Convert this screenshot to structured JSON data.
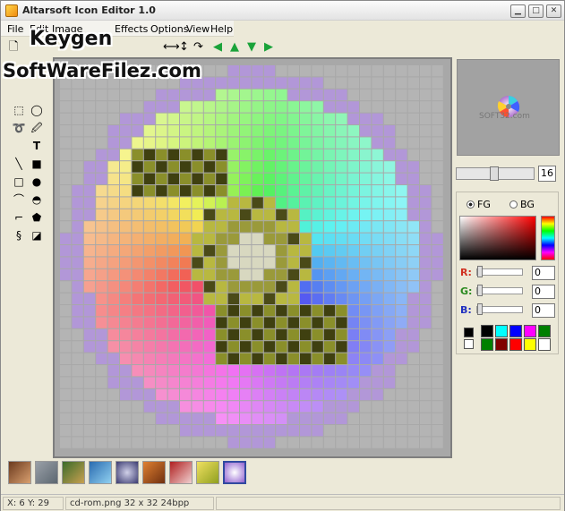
{
  "window": {
    "title": "Altarsoft Icon Editor 1.0",
    "controls": {
      "minimize": "0",
      "maximize": "1",
      "close": "r"
    }
  },
  "menu": [
    "File",
    "Edit",
    "Image",
    "Effects",
    "Options",
    "View",
    "Help"
  ],
  "toolbar": {
    "icons": [
      "new-icon",
      "open-icon",
      "flip-horizontal-icon",
      "flip-vertical-icon",
      "rotate-icon",
      "shift-left-icon",
      "shift-up-icon",
      "shift-down-icon",
      "shift-right-icon"
    ]
  },
  "tools": [
    "rect-select-tool",
    "ellipse-select-tool",
    "lasso-tool",
    "eyedropper-tool",
    "text-tool",
    "line-tool",
    "filled-rect-tool",
    "rect-tool",
    "ellipse-tool",
    "arc-tool",
    "filled-arc-tool",
    "curve-tool",
    "polygon-tool",
    "spiral-tool",
    "fill-tool"
  ],
  "brush_size": "16",
  "color": {
    "fg_label": "FG",
    "bg_label": "BG",
    "selected": "FG",
    "r_label": "R:",
    "g_label": "G:",
    "b_label": "B:",
    "r_value": "0",
    "g_value": "0",
    "b_value": "0",
    "fg_color": "#000000",
    "bg_color": "#ffffff",
    "palette": [
      "#000000",
      "#00ffff",
      "#0000ff",
      "#ff00ff",
      "#008000",
      "#008000",
      "#800000",
      "#ff0000",
      "#ffff00",
      "#ffffff"
    ]
  },
  "watermark": {
    "line1": "Keygen",
    "line2": "SoftWareFilez.com",
    "preview_text": "SOFT32.com"
  },
  "thumbnails": [
    "thumb-1",
    "thumb-2",
    "thumb-3",
    "thumb-4",
    "thumb-5",
    "thumb-6",
    "thumb-7",
    "thumb-8",
    "thumb-9"
  ],
  "status": {
    "coords": "X: 6 Y: 29",
    "file": "cd-rom.png 32 x 32 24bpp"
  }
}
